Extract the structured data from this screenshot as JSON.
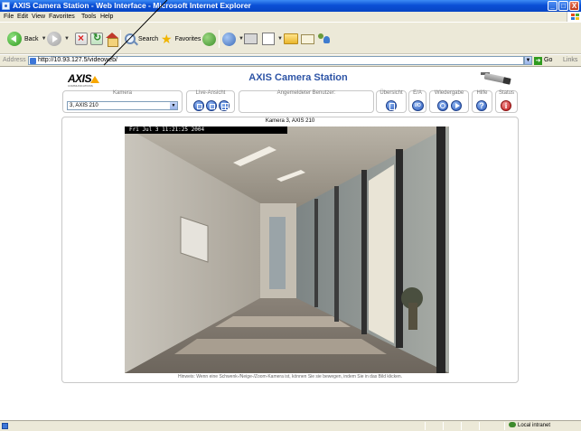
{
  "window": {
    "title": "AXIS Camera Station - Web Interface - Microsoft Internet Explorer",
    "minimize": "_",
    "maximize": "□",
    "close": "X"
  },
  "menu": [
    "File",
    "Edit",
    "View",
    "Favorites",
    "Tools",
    "Help"
  ],
  "toolbar": {
    "back_label": "Back",
    "search_label": "Search",
    "favorites_label": "Favorites"
  },
  "address": {
    "label": "Address",
    "url": "http://10.93.127.5/videoweb/",
    "go_label": "Go",
    "links_label": "Links"
  },
  "page": {
    "brand": "AXIS",
    "brand_tagline": "COMMUNICATIONS",
    "title": "AXIS Camera Station",
    "camera_panel": {
      "label": "Kamera",
      "selected": "3, AXIS 210",
      "dropdown_arrow": "▼"
    },
    "live_panel": {
      "label": "Live-Ansicht"
    },
    "user_panel": {
      "label": "Angemeldeter Benutzer:",
      "value": ""
    },
    "overview_panel": {
      "label": "Übersicht"
    },
    "io_panel": {
      "label": "E/A",
      "button_text": "I/O"
    },
    "playback_panel": {
      "label": "Wiedergabe"
    },
    "help_panel": {
      "label": "Hilfe",
      "button_text": "?"
    },
    "status_panel": {
      "label": "Status",
      "button_text": "i"
    },
    "video": {
      "caption": "Kamera 3, AXIS 210",
      "timestamp": "Fri Jul  3 11:21:25 2004"
    },
    "hint": "Hinweis: Wenn eine Schwenk-/Neige-/Zoom-Kamera ist, können Sie sie bewegen, indem Sie in das Bild klicken."
  },
  "statusbar": {
    "zone": "Local intranet"
  },
  "colors": {
    "title_blue": "#2d54a6",
    "axis_orange": "#f7a700",
    "xp_blue": "#0a4fd6"
  }
}
